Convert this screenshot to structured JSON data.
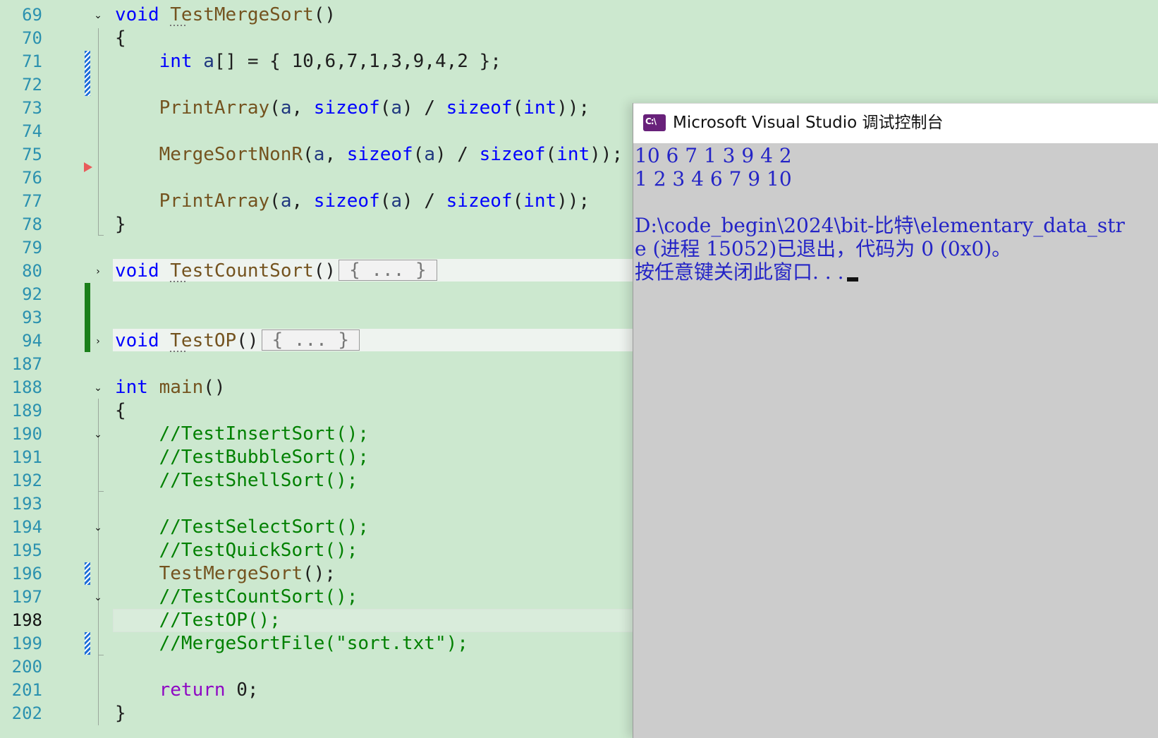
{
  "editor": {
    "lines": [
      {
        "n": "69",
        "code": "void TestMergeSort()"
      },
      {
        "n": "70",
        "code": "{"
      },
      {
        "n": "71",
        "code": "int a[] = { 10,6,7,1,3,9,4,2 };"
      },
      {
        "n": "72",
        "code": ""
      },
      {
        "n": "73",
        "code": "PrintArray(a, sizeof(a) / sizeof(int));"
      },
      {
        "n": "74",
        "code": ""
      },
      {
        "n": "75",
        "code": "MergeSortNonR(a, sizeof(a) / sizeof(int));"
      },
      {
        "n": "76",
        "code": ""
      },
      {
        "n": "77",
        "code": "PrintArray(a, sizeof(a) / sizeof(int));"
      },
      {
        "n": "78",
        "code": "}"
      },
      {
        "n": "79",
        "code": ""
      },
      {
        "n": "80",
        "code": "void TestCountSort()"
      },
      {
        "n": "92",
        "code": ""
      },
      {
        "n": "93",
        "code": ""
      },
      {
        "n": "94",
        "code": "void TestOP()"
      },
      {
        "n": "187",
        "code": ""
      },
      {
        "n": "188",
        "code": "int main()"
      },
      {
        "n": "189",
        "code": "{"
      },
      {
        "n": "190",
        "code": "//TestInsertSort();"
      },
      {
        "n": "191",
        "code": "//TestBubbleSort();"
      },
      {
        "n": "192",
        "code": "//TestShellSort();"
      },
      {
        "n": "193",
        "code": ""
      },
      {
        "n": "194",
        "code": "//TestSelectSort();"
      },
      {
        "n": "195",
        "code": "//TestQuickSort();"
      },
      {
        "n": "196",
        "code": "TestMergeSort();"
      },
      {
        "n": "197",
        "code": "//TestCountSort();"
      },
      {
        "n": "198",
        "code": "//TestOP();"
      },
      {
        "n": "199",
        "code": "//MergeSortFile(\"sort.txt\");"
      },
      {
        "n": "200",
        "code": ""
      },
      {
        "n": "201",
        "code": "return 0;"
      },
      {
        "n": "202",
        "code": "}"
      }
    ],
    "collapsed_placeholder": "{ ... }",
    "current_line": "198"
  },
  "console": {
    "title": "Microsoft Visual Studio 调试控制台",
    "icon_label": "C:\\",
    "output": [
      "10 6 7 1 3 9 4 2",
      "1 2 3 4 6 7 9 10",
      "",
      "D:\\code_begin\\2024\\bit-比特\\elementary_data_str",
      "e (进程 15052)已退出，代码为 0 (0x0)。",
      "按任意键关闭此窗口. . ."
    ]
  }
}
